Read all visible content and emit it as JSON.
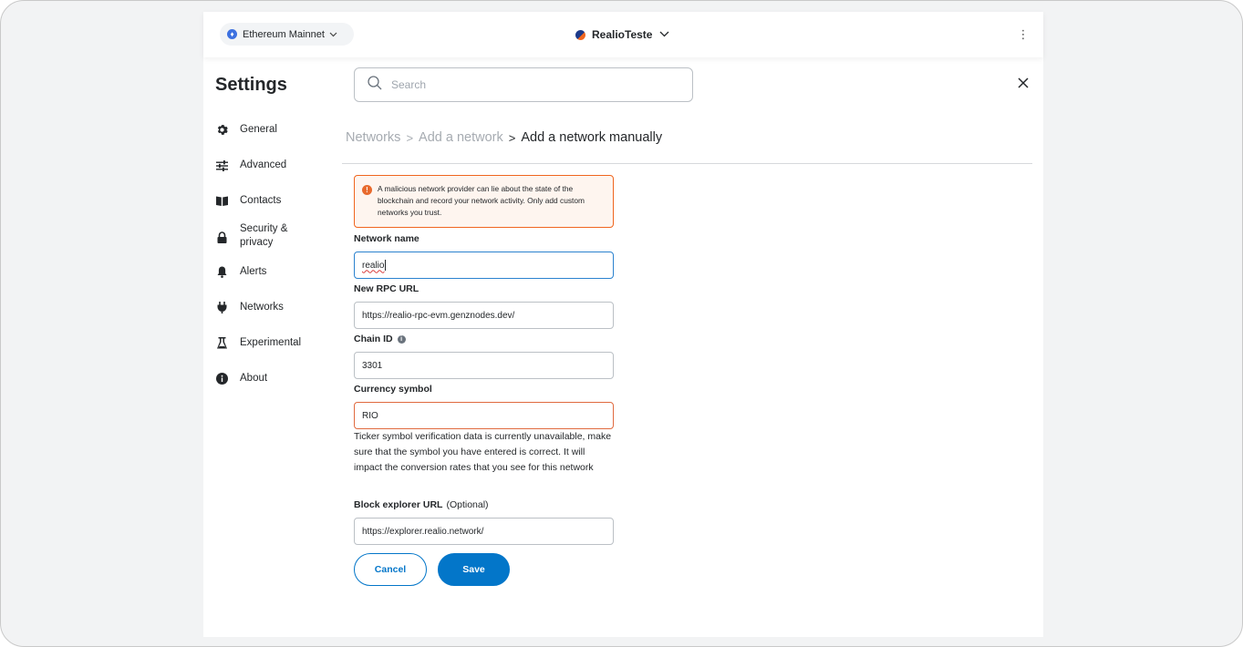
{
  "header": {
    "network_label": "Ethereum Mainnet",
    "account_name": "RealioTeste",
    "menu_glyph": "⋮"
  },
  "settings": {
    "title": "Settings",
    "nav": [
      {
        "label": "General",
        "icon": "gear-icon"
      },
      {
        "label": "Advanced",
        "icon": "sliders-icon"
      },
      {
        "label": "Contacts",
        "icon": "book-icon"
      },
      {
        "label": "Security &\nprivacy",
        "icon": "lock-icon"
      },
      {
        "label": "Alerts",
        "icon": "bell-icon"
      },
      {
        "label": "Networks",
        "icon": "plug-icon"
      },
      {
        "label": "Experimental",
        "icon": "flask-icon"
      },
      {
        "label": "About",
        "icon": "info-icon"
      }
    ]
  },
  "search": {
    "placeholder": "Search"
  },
  "breadcrumb": {
    "networks": "Networks",
    "add_network": "Add a network",
    "current": "Add a network manually",
    "separator": ">"
  },
  "warning": {
    "text": "A malicious network provider can lie about the state of the blockchain and record your network activity. Only add custom networks you trust."
  },
  "form": {
    "network_name": {
      "label": "Network name",
      "value": "realio"
    },
    "rpc_url": {
      "label": "New RPC URL",
      "value": "https://realio-rpc-evm.genznodes.dev/"
    },
    "chain_id": {
      "label": "Chain ID",
      "value": "3301"
    },
    "currency_symbol": {
      "label": "Currency symbol",
      "value": "RIO",
      "help": "Ticker symbol verification data is currently unavailable, make sure that the symbol you have entered is correct. It will impact the conversion rates that you see for this network"
    },
    "block_explorer": {
      "label": "Block explorer URL",
      "optional": "(Optional)",
      "value": "https://explorer.realio.network/"
    }
  },
  "buttons": {
    "cancel": "Cancel",
    "save": "Save"
  },
  "colors": {
    "primary": "#0376c9",
    "warning_border": "#f0661f",
    "warning_bg": "#fef5ef",
    "focus_border": "#2b82cf",
    "text": "#24272a",
    "muted": "#a6abb1"
  }
}
